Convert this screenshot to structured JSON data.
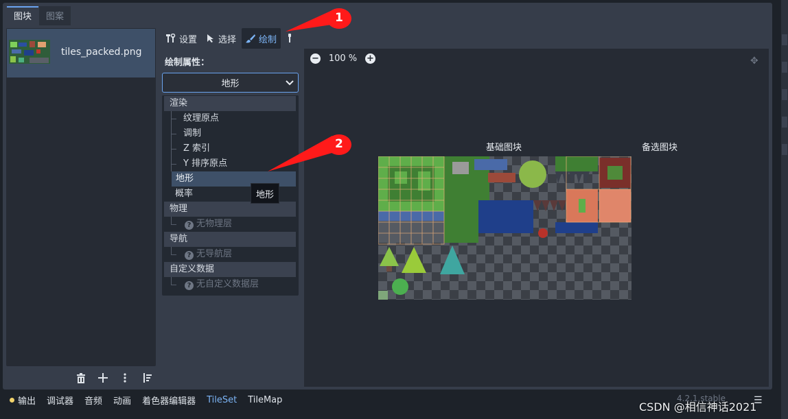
{
  "top_tabs": [
    {
      "label": "图块",
      "active": true
    },
    {
      "label": "图案",
      "active": false
    }
  ],
  "file_list": {
    "items": [
      {
        "name": "tiles_packed.png",
        "selected": true
      }
    ],
    "toolbar": {
      "delete_icon": "trash-icon",
      "add_icon": "plus-icon",
      "more_icon": "kebab-icon",
      "sort_icon": "sort-icon"
    }
  },
  "mode_bar": {
    "setup": "设置",
    "select": "选择",
    "paint": "绘制",
    "active": "paint"
  },
  "paint_props": {
    "label": "绘制属性：",
    "selected": "地形"
  },
  "tree": {
    "render_section": "渲染",
    "render_items": [
      "纹理原点",
      "调制",
      "Z 索引",
      "Y 排序原点"
    ],
    "terrain": "地形",
    "probability": "概率",
    "physics_section": "物理",
    "physics_empty": "无物理层",
    "nav_section": "导航",
    "nav_empty": "无导航层",
    "custom_section": "自定义数据",
    "custom_empty": "无自定义数据层"
  },
  "tooltip": "地形",
  "canvas": {
    "zoom": "100 %",
    "base_tiles_label": "基础图块",
    "alt_tiles_label": "备选图块"
  },
  "bottom_bar": {
    "items": [
      "输出",
      "调试器",
      "音频",
      "动画",
      "着色器编辑器",
      "TileSet",
      "TileMap"
    ],
    "active": "TileSet",
    "version": "4.2.1.stable"
  },
  "watermark": "CSDN @相信神话2021",
  "annotations": [
    "1",
    "2"
  ],
  "colors": {
    "accent": "#6aa4f0",
    "annotation": "#ff1a1a",
    "grass": "#5fae4a",
    "water": "#1f3f8a"
  }
}
